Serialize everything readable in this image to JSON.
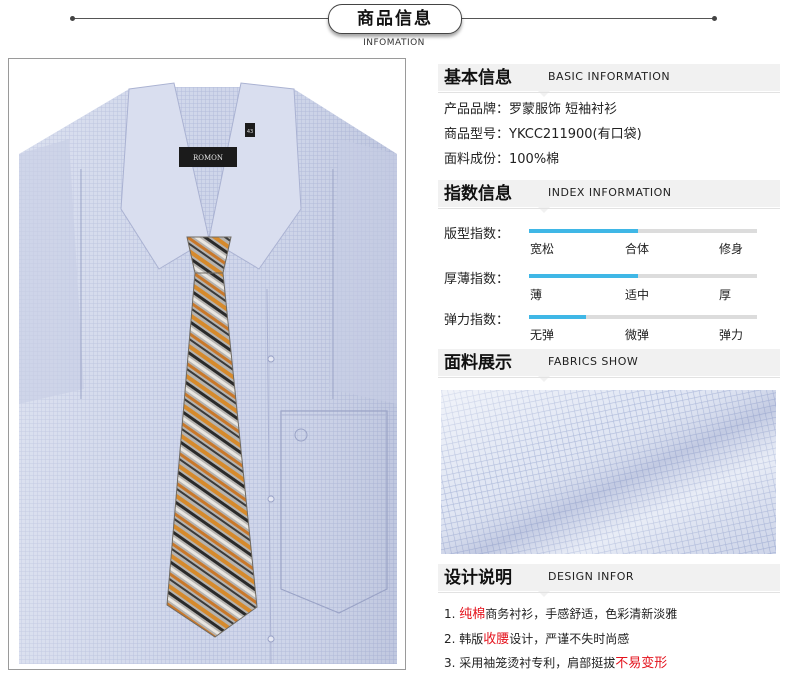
{
  "banner": {
    "title": "商品信息",
    "subtitle": "INFOMATION"
  },
  "basic": {
    "title_cn": "基本信息",
    "title_en": "BASIC INFORMATION",
    "rows": [
      "产品品牌：罗蒙服饰 短袖衬衫",
      "商品型号：YKCC211900(有口袋)",
      "面料成份：100%棉"
    ]
  },
  "index": {
    "title_cn": "指数信息",
    "title_en": "INDEX INFORMATION",
    "items": [
      {
        "label": "版型指数：",
        "ticks": [
          "宽松",
          "合体",
          "修身"
        ],
        "level": 0.48
      },
      {
        "label": "厚薄指数：",
        "ticks": [
          "薄",
          "适中",
          "厚"
        ],
        "level": 0.48
      },
      {
        "label": "弹力指数：",
        "ticks": [
          "无弹",
          "微弹",
          "弹力"
        ],
        "level": 0.25
      }
    ],
    "accent_color": "#3fb7e6"
  },
  "fabrics": {
    "title_cn": "面料展示",
    "title_en": "FABRICS SHOW"
  },
  "design": {
    "title_cn": "设计说明",
    "title_en": "DESIGN INFOR",
    "rows": [
      {
        "pre": "1. ",
        "red": "纯棉",
        "post": "商务衬衫，手感舒适，色彩清新淡雅"
      },
      {
        "pre": "2. 韩版",
        "red": "收腰",
        "post": "设计，严谨不失时尚感"
      },
      {
        "pre": "3. 采用袖笼烫衬专利，肩部挺拔",
        "red": "不易变形",
        "post": ""
      }
    ],
    "highlight_color": "#e4121c"
  },
  "photo": {
    "brand_label": "ROMON",
    "size_tag": "43"
  }
}
